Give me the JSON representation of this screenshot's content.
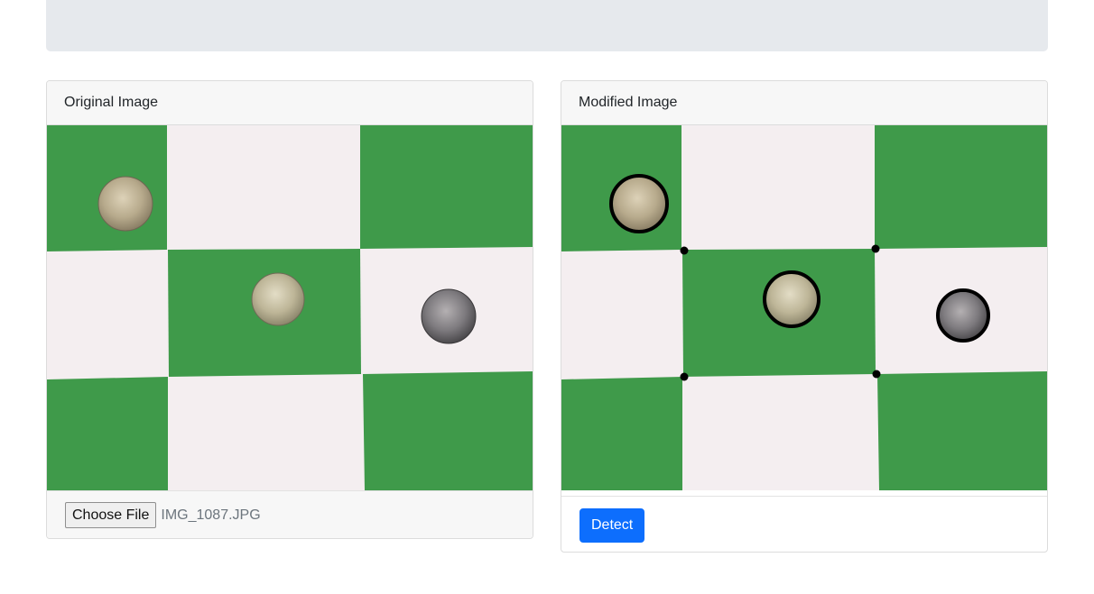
{
  "colors": {
    "green": "#3f9a4a",
    "white_square": "#f4eef0",
    "primary": "#0d6efd",
    "annotation": "#000000"
  },
  "original_card": {
    "title": "Original Image",
    "file_button_label": "Choose File",
    "file_name": "IMG_1087.JPG"
  },
  "modified_card": {
    "title": "Modified Image",
    "detect_button_label": "Detect"
  }
}
